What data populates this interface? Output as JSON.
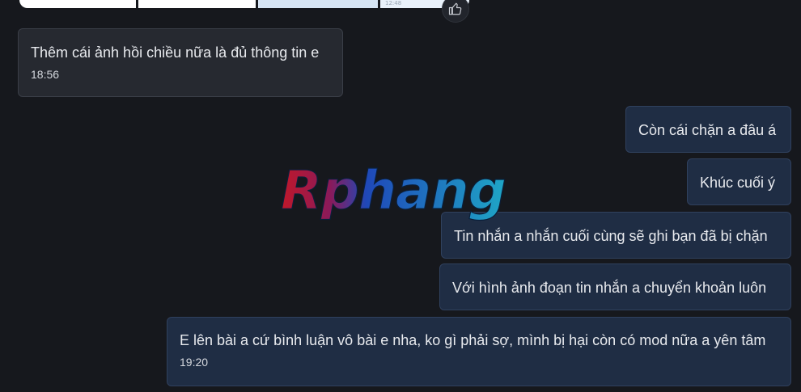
{
  "watermark": {
    "text": "Rphang",
    "colors": {
      "red": "#c0182a",
      "blue": "#1f48b8",
      "cyan": "#1fa6c6"
    }
  },
  "top_image": {
    "timestamp": "12:48"
  },
  "reaction": {
    "icon": "thumbs-up-icon"
  },
  "messages": [
    {
      "direction": "incoming",
      "text": "Thêm cái ảnh hồi chiều nữa là đủ thông tin e",
      "time": "18:56"
    },
    {
      "direction": "outgoing",
      "text": "Còn cái chặn a đâu á"
    },
    {
      "direction": "outgoing",
      "text": "Khúc cuối ý"
    },
    {
      "direction": "outgoing",
      "text": "Tin nhắn a nhắn cuối cùng sẽ ghi bạn đã bị chặn"
    },
    {
      "direction": "outgoing",
      "text": "Với hình ảnh đoạn tin nhắn a chuyển khoản luôn"
    },
    {
      "direction": "outgoing",
      "text": "E lên bài a cứ bình luận vô bài e nha, ko gì phải sợ, mình bị hại còn có mod nữa a yên tâm",
      "time": "19:20"
    }
  ],
  "theme": {
    "background": "#16181d",
    "incoming_bubble": "#262930",
    "outgoing_bubble": "#1f2d44"
  }
}
